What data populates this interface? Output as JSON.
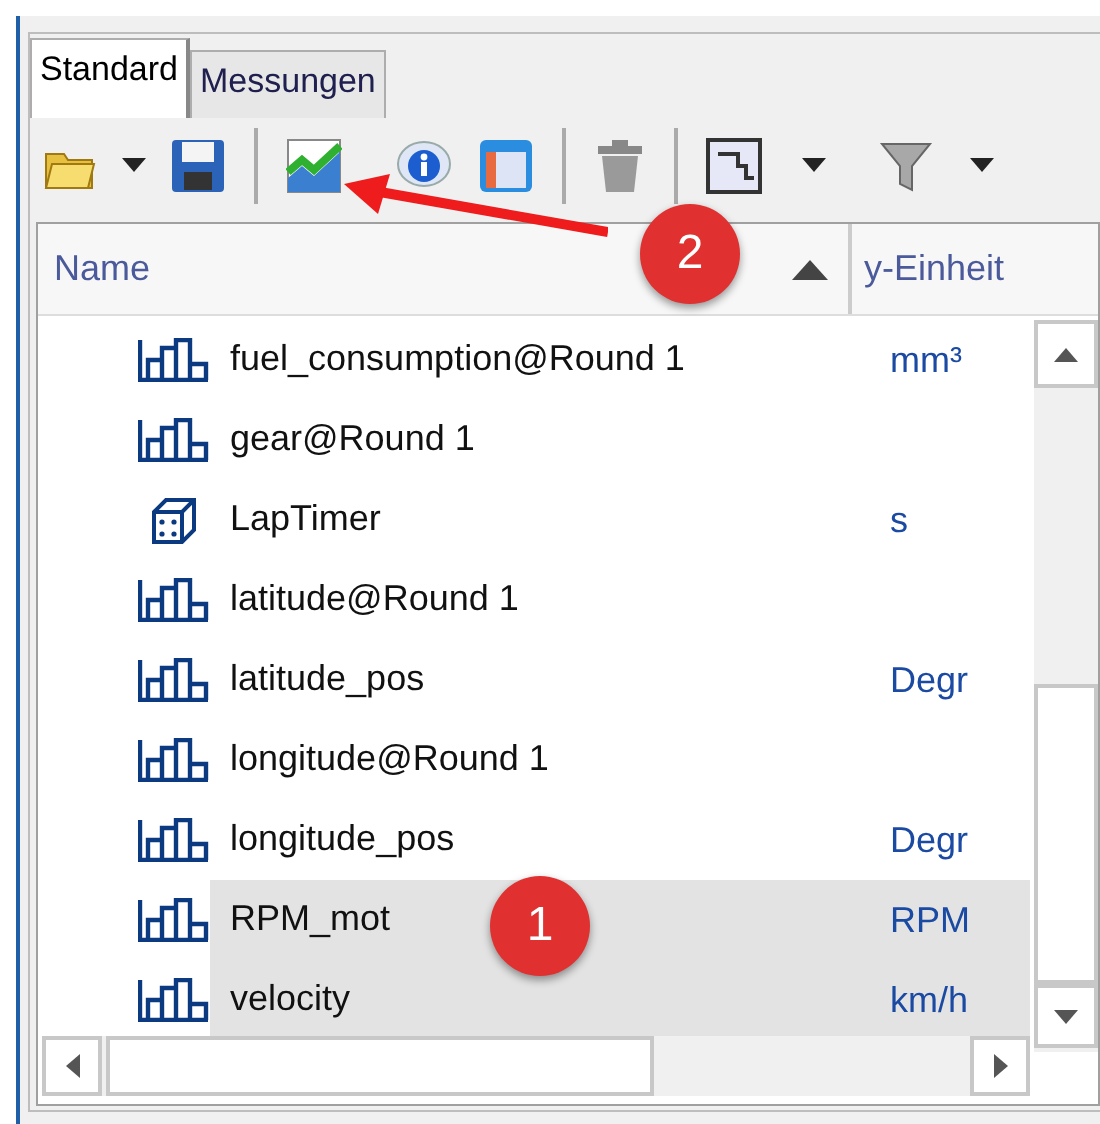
{
  "tabs": [
    {
      "label": "Standard",
      "selected": true
    },
    {
      "label": "Messungen",
      "selected": false
    }
  ],
  "columns": [
    {
      "label": "Name",
      "sorted": true
    },
    {
      "label": "y-Einheit",
      "sorted": false
    }
  ],
  "rows": [
    {
      "kind": "channel",
      "name": "fuel_consumption@Round 1",
      "unit": "mm³",
      "selected": false
    },
    {
      "kind": "channel",
      "name": "gear@Round 1",
      "selected": false
    },
    {
      "kind": "timer",
      "name": "LapTimer",
      "unit": "s",
      "selected": false
    },
    {
      "kind": "channel",
      "name": "latitude@Round 1",
      "selected": false
    },
    {
      "kind": "channel",
      "name": "latitude_pos",
      "unit": "Degr",
      "selected": false
    },
    {
      "kind": "channel",
      "name": "longitude@Round 1",
      "selected": false
    },
    {
      "kind": "channel",
      "name": "longitude_pos",
      "unit": "Degr",
      "selected": false
    },
    {
      "kind": "channel",
      "name": "RPM_mot",
      "unit": "RPM",
      "selected": true
    },
    {
      "kind": "channel",
      "name": "velocity",
      "unit": "km/h",
      "selected": true
    }
  ],
  "callouts": [
    {
      "label": "2",
      "kind": "arrow"
    },
    {
      "label": "1",
      "kind": "plain"
    }
  ]
}
